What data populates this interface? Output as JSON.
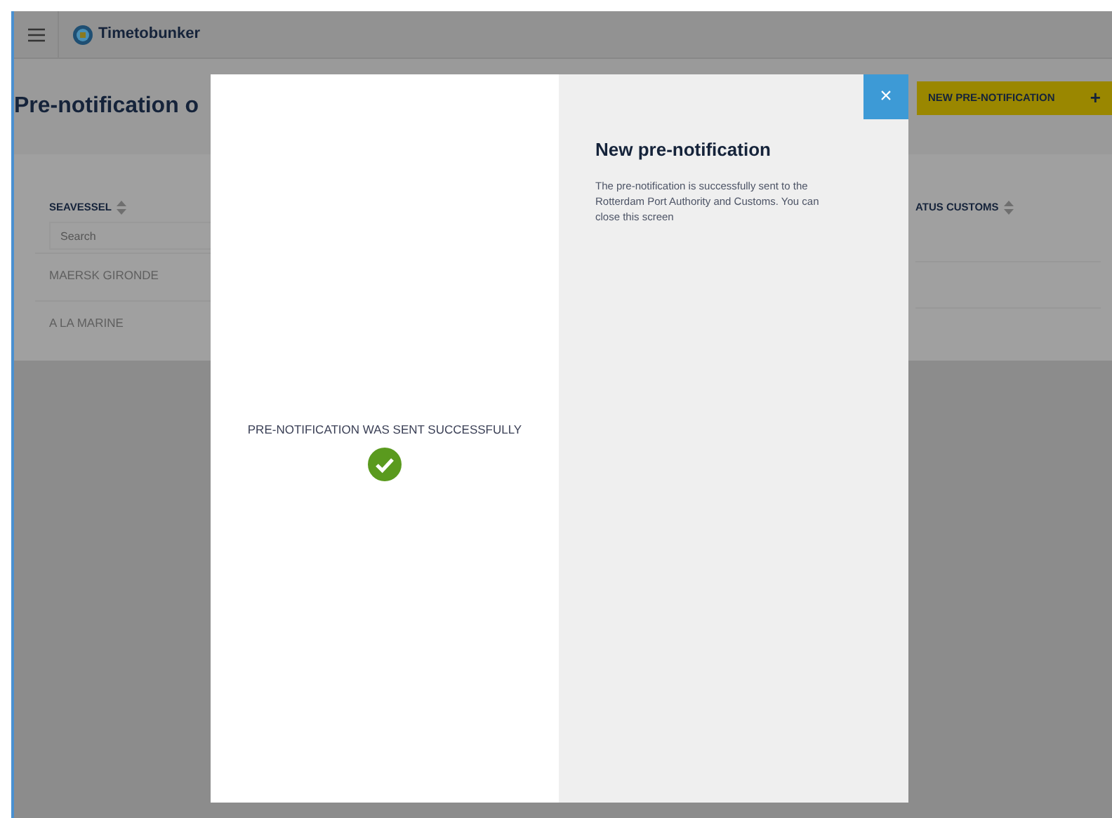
{
  "app": {
    "name": "Timetobunker"
  },
  "page": {
    "title": "Pre-notification o",
    "new_button": "NEW PRE-NOTIFICATION",
    "new_button_icon": "+"
  },
  "table": {
    "columns": [
      {
        "label": "SEAVESSEL",
        "search_placeholder": "Search"
      },
      {
        "label": "ATUS CUSTOMS"
      }
    ],
    "rows": [
      {
        "seavessel": "MAERSK GIRONDE"
      },
      {
        "seavessel": "A LA MARINE"
      }
    ]
  },
  "modal": {
    "message": "PRE-NOTIFICATION WAS SENT SUCCESSFULLY",
    "title": "New pre-notification",
    "body": "The pre-notification is successfully sent to the Rotterdam Port Authority and Customs. You can close this screen",
    "close": "×"
  }
}
